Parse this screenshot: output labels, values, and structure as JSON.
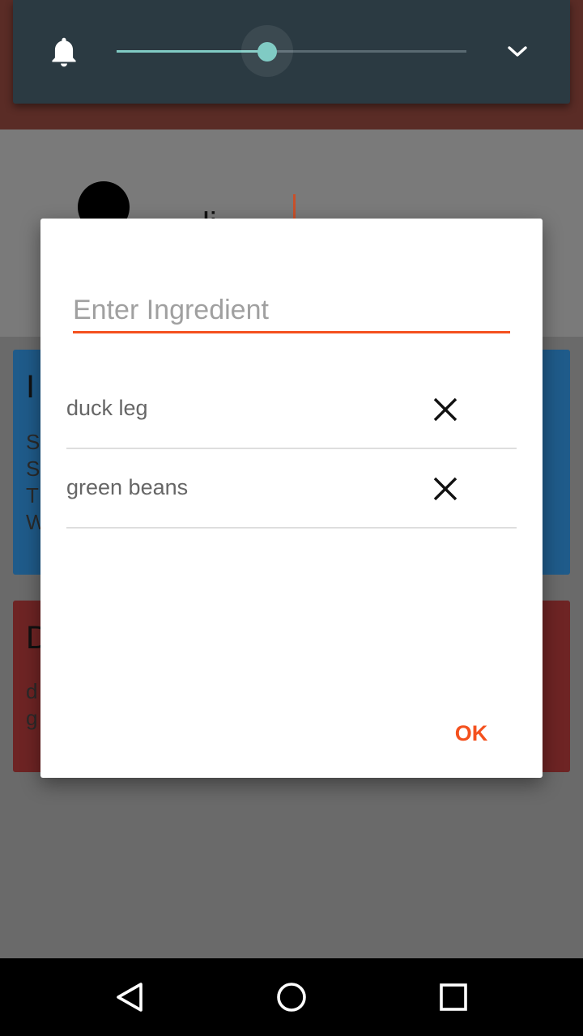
{
  "background_app": {
    "title_fragment": "li",
    "card_blue": {
      "title_fragment": "I",
      "line_fragments": [
        "S",
        "S",
        "T",
        "W"
      ]
    },
    "card_red": {
      "title_fragment": "D",
      "line_fragments": [
        "d",
        "g"
      ]
    }
  },
  "volume_panel": {
    "icon": "bell-icon",
    "level": 0.43,
    "expand_icon": "chevron-down-icon",
    "accent_color": "#80cbc4"
  },
  "dialog": {
    "input": {
      "placeholder": "Enter Ingredient",
      "value": "",
      "accent_color": "#f4511e"
    },
    "ingredients": [
      {
        "name": "duck leg",
        "remove_icon": "close-icon"
      },
      {
        "name": "green beans",
        "remove_icon": "close-icon"
      }
    ],
    "ok_label": "OK"
  },
  "nav_bar": {
    "back_icon": "back-triangle-icon",
    "home_icon": "home-circle-icon",
    "recents_icon": "recents-square-icon"
  }
}
